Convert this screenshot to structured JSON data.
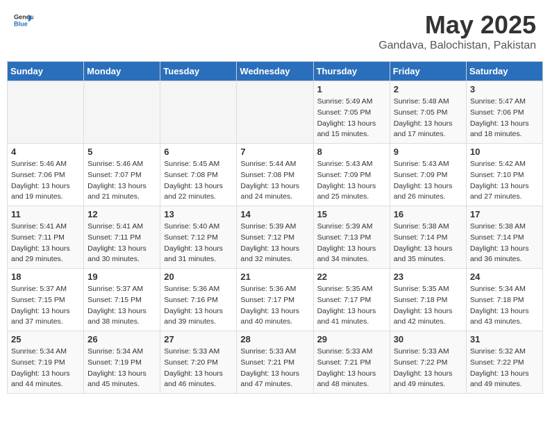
{
  "logo": {
    "general": "General",
    "blue": "Blue"
  },
  "header": {
    "month_year": "May 2025",
    "location": "Gandava, Balochistan, Pakistan"
  },
  "weekdays": [
    "Sunday",
    "Monday",
    "Tuesday",
    "Wednesday",
    "Thursday",
    "Friday",
    "Saturday"
  ],
  "weeks": [
    [
      {
        "day": "",
        "sunrise": "",
        "sunset": "",
        "daylight": ""
      },
      {
        "day": "",
        "sunrise": "",
        "sunset": "",
        "daylight": ""
      },
      {
        "day": "",
        "sunrise": "",
        "sunset": "",
        "daylight": ""
      },
      {
        "day": "",
        "sunrise": "",
        "sunset": "",
        "daylight": ""
      },
      {
        "day": "1",
        "sunrise": "Sunrise: 5:49 AM",
        "sunset": "Sunset: 7:05 PM",
        "daylight": "Daylight: 13 hours and 15 minutes."
      },
      {
        "day": "2",
        "sunrise": "Sunrise: 5:48 AM",
        "sunset": "Sunset: 7:05 PM",
        "daylight": "Daylight: 13 hours and 17 minutes."
      },
      {
        "day": "3",
        "sunrise": "Sunrise: 5:47 AM",
        "sunset": "Sunset: 7:06 PM",
        "daylight": "Daylight: 13 hours and 18 minutes."
      }
    ],
    [
      {
        "day": "4",
        "sunrise": "Sunrise: 5:46 AM",
        "sunset": "Sunset: 7:06 PM",
        "daylight": "Daylight: 13 hours and 19 minutes."
      },
      {
        "day": "5",
        "sunrise": "Sunrise: 5:46 AM",
        "sunset": "Sunset: 7:07 PM",
        "daylight": "Daylight: 13 hours and 21 minutes."
      },
      {
        "day": "6",
        "sunrise": "Sunrise: 5:45 AM",
        "sunset": "Sunset: 7:08 PM",
        "daylight": "Daylight: 13 hours and 22 minutes."
      },
      {
        "day": "7",
        "sunrise": "Sunrise: 5:44 AM",
        "sunset": "Sunset: 7:08 PM",
        "daylight": "Daylight: 13 hours and 24 minutes."
      },
      {
        "day": "8",
        "sunrise": "Sunrise: 5:43 AM",
        "sunset": "Sunset: 7:09 PM",
        "daylight": "Daylight: 13 hours and 25 minutes."
      },
      {
        "day": "9",
        "sunrise": "Sunrise: 5:43 AM",
        "sunset": "Sunset: 7:09 PM",
        "daylight": "Daylight: 13 hours and 26 minutes."
      },
      {
        "day": "10",
        "sunrise": "Sunrise: 5:42 AM",
        "sunset": "Sunset: 7:10 PM",
        "daylight": "Daylight: 13 hours and 27 minutes."
      }
    ],
    [
      {
        "day": "11",
        "sunrise": "Sunrise: 5:41 AM",
        "sunset": "Sunset: 7:11 PM",
        "daylight": "Daylight: 13 hours and 29 minutes."
      },
      {
        "day": "12",
        "sunrise": "Sunrise: 5:41 AM",
        "sunset": "Sunset: 7:11 PM",
        "daylight": "Daylight: 13 hours and 30 minutes."
      },
      {
        "day": "13",
        "sunrise": "Sunrise: 5:40 AM",
        "sunset": "Sunset: 7:12 PM",
        "daylight": "Daylight: 13 hours and 31 minutes."
      },
      {
        "day": "14",
        "sunrise": "Sunrise: 5:39 AM",
        "sunset": "Sunset: 7:12 PM",
        "daylight": "Daylight: 13 hours and 32 minutes."
      },
      {
        "day": "15",
        "sunrise": "Sunrise: 5:39 AM",
        "sunset": "Sunset: 7:13 PM",
        "daylight": "Daylight: 13 hours and 34 minutes."
      },
      {
        "day": "16",
        "sunrise": "Sunrise: 5:38 AM",
        "sunset": "Sunset: 7:14 PM",
        "daylight": "Daylight: 13 hours and 35 minutes."
      },
      {
        "day": "17",
        "sunrise": "Sunrise: 5:38 AM",
        "sunset": "Sunset: 7:14 PM",
        "daylight": "Daylight: 13 hours and 36 minutes."
      }
    ],
    [
      {
        "day": "18",
        "sunrise": "Sunrise: 5:37 AM",
        "sunset": "Sunset: 7:15 PM",
        "daylight": "Daylight: 13 hours and 37 minutes."
      },
      {
        "day": "19",
        "sunrise": "Sunrise: 5:37 AM",
        "sunset": "Sunset: 7:15 PM",
        "daylight": "Daylight: 13 hours and 38 minutes."
      },
      {
        "day": "20",
        "sunrise": "Sunrise: 5:36 AM",
        "sunset": "Sunset: 7:16 PM",
        "daylight": "Daylight: 13 hours and 39 minutes."
      },
      {
        "day": "21",
        "sunrise": "Sunrise: 5:36 AM",
        "sunset": "Sunset: 7:17 PM",
        "daylight": "Daylight: 13 hours and 40 minutes."
      },
      {
        "day": "22",
        "sunrise": "Sunrise: 5:35 AM",
        "sunset": "Sunset: 7:17 PM",
        "daylight": "Daylight: 13 hours and 41 minutes."
      },
      {
        "day": "23",
        "sunrise": "Sunrise: 5:35 AM",
        "sunset": "Sunset: 7:18 PM",
        "daylight": "Daylight: 13 hours and 42 minutes."
      },
      {
        "day": "24",
        "sunrise": "Sunrise: 5:34 AM",
        "sunset": "Sunset: 7:18 PM",
        "daylight": "Daylight: 13 hours and 43 minutes."
      }
    ],
    [
      {
        "day": "25",
        "sunrise": "Sunrise: 5:34 AM",
        "sunset": "Sunset: 7:19 PM",
        "daylight": "Daylight: 13 hours and 44 minutes."
      },
      {
        "day": "26",
        "sunrise": "Sunrise: 5:34 AM",
        "sunset": "Sunset: 7:19 PM",
        "daylight": "Daylight: 13 hours and 45 minutes."
      },
      {
        "day": "27",
        "sunrise": "Sunrise: 5:33 AM",
        "sunset": "Sunset: 7:20 PM",
        "daylight": "Daylight: 13 hours and 46 minutes."
      },
      {
        "day": "28",
        "sunrise": "Sunrise: 5:33 AM",
        "sunset": "Sunset: 7:21 PM",
        "daylight": "Daylight: 13 hours and 47 minutes."
      },
      {
        "day": "29",
        "sunrise": "Sunrise: 5:33 AM",
        "sunset": "Sunset: 7:21 PM",
        "daylight": "Daylight: 13 hours and 48 minutes."
      },
      {
        "day": "30",
        "sunrise": "Sunrise: 5:33 AM",
        "sunset": "Sunset: 7:22 PM",
        "daylight": "Daylight: 13 hours and 49 minutes."
      },
      {
        "day": "31",
        "sunrise": "Sunrise: 5:32 AM",
        "sunset": "Sunset: 7:22 PM",
        "daylight": "Daylight: 13 hours and 49 minutes."
      }
    ]
  ]
}
